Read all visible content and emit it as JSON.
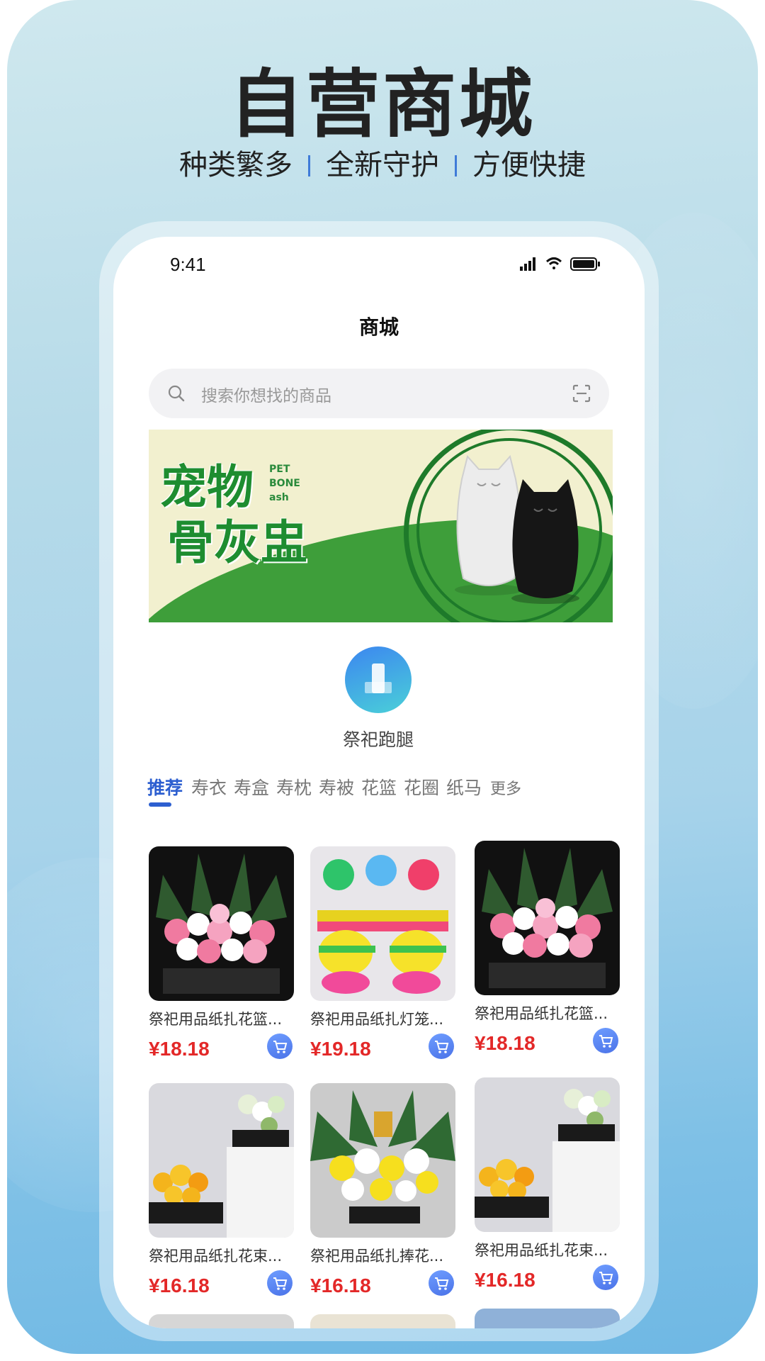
{
  "poster": {
    "headline": "自营商城",
    "tagline": [
      "种类繁多",
      "全新守护",
      "方便快捷"
    ]
  },
  "status_bar": {
    "time": "9:41"
  },
  "page": {
    "title": "商城"
  },
  "search": {
    "placeholder": "搜索你想找的商品"
  },
  "banner": {
    "title_line1": "宠物",
    "title_line2": "骨灰盅",
    "small_text": [
      "PET",
      "BONE",
      "ash"
    ]
  },
  "categories": [
    {
      "label": "祭祀跑腿",
      "icon": "building-icon"
    }
  ],
  "tabs": [
    "推荐",
    "寿衣",
    "寿盒",
    "寿枕",
    "寿被",
    "花篮",
    "花圈",
    "纸马",
    "更多"
  ],
  "products": [
    {
      "name": "祭祀用品纸扎花篮...",
      "price": "¥18.18",
      "image": "flower-basket"
    },
    {
      "name": "祭祀用品纸扎灯笼...",
      "price": "¥19.18",
      "image": "paper-lantern"
    },
    {
      "name": "祭祀用品纸扎花篮...",
      "price": "¥18.18",
      "image": "flower-basket"
    },
    {
      "name": "祭祀用品纸扎花束...",
      "price": "¥16.18",
      "image": "flower-bouquet"
    },
    {
      "name": "祭祀用品纸扎捧花...",
      "price": "¥16.18",
      "image": "flower-arrangement"
    },
    {
      "name": "祭祀用品纸扎花束...",
      "price": "¥16.18",
      "image": "flower-bouquet"
    }
  ],
  "colors": {
    "accent": "#2d5fd0",
    "price": "#e32828"
  }
}
